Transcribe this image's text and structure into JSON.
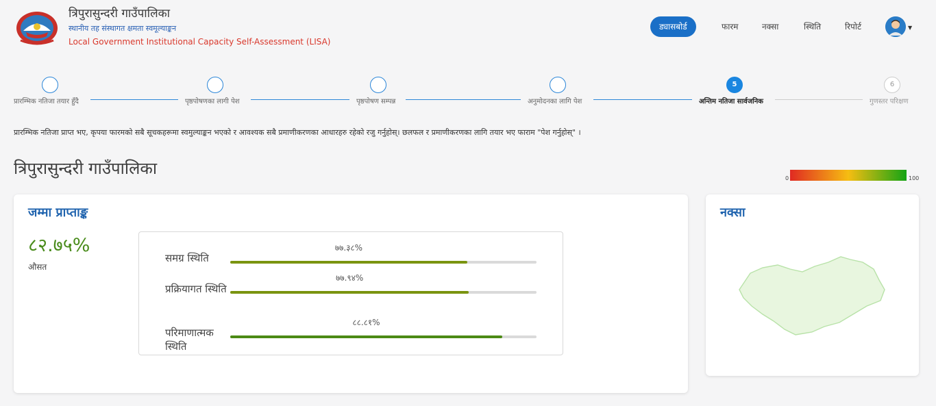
{
  "header": {
    "title": "त्रिपुरासुन्दरी गाउँपालिका",
    "subtitle_np": "स्थानीय तह संस्थागत क्षमता स्वमूल्याङ्कन",
    "subtitle_en": "Local Government Institutional Capacity Self-Assessment (LISA)"
  },
  "nav": {
    "items": [
      "ड्यासबोर्ड",
      "फारम",
      "नक्सा",
      "स्थिति",
      "रिपोर्ट"
    ],
    "active_index": 0
  },
  "stepper": {
    "steps": [
      {
        "label": "प्रारम्भिक नतिजा तयार हुँदै",
        "number": ""
      },
      {
        "label": "पृष्ठपोषणका लागी पेश",
        "number": ""
      },
      {
        "label": "पृष्ठपोषण सम्पन्न",
        "number": ""
      },
      {
        "label": "अनुमोदनका लागि पेश",
        "number": ""
      },
      {
        "label": "अन्तिम नतिजा सार्वजनिक",
        "number": "5"
      },
      {
        "label": "गुणस्तर परिक्षण",
        "number": "6"
      }
    ],
    "active_index": 4
  },
  "instruction": "प्रारम्भिक नतिजा प्राप्त भए, कृपया फारमको सबै सूचकहरूमा स्वमुल्याङ्कन भएको र आवश्यक सबै प्रमाणीकरणका आधारहरु रहेको रजु गर्नुहोस्। छलफल र प्रमाणीकरणका लागि तयार भए फाराम \"पेश गर्नुहोस्\" ।",
  "page_title": "त्रिपुरासुन्दरी गाउँपालिका",
  "legend": {
    "min": "0",
    "max": "100",
    "colors": [
      "#e02a22",
      "#f6bd12",
      "#14a414"
    ]
  },
  "score_card": {
    "title": "जम्मा प्राप्ताङ्क",
    "score": "८२.७५%",
    "score_label": "औसत",
    "bars": [
      {
        "name": "समग्र स्थिति",
        "value_text": "७७.३८%",
        "value": 77.38,
        "color": "#7a9410"
      },
      {
        "name": "प्रक्रियागत स्थिति",
        "value_text": "७७.९४%",
        "value": 77.94,
        "color": "#7a9410"
      },
      {
        "name": "परिमाणात्मक स्थिति",
        "value_text": "८८.८१%",
        "value": 88.81,
        "color": "#4b8a15"
      }
    ]
  },
  "map_card": {
    "title": "नक्सा",
    "fill_color": "#e8f6df",
    "stroke_color": "#b8e2a8"
  }
}
